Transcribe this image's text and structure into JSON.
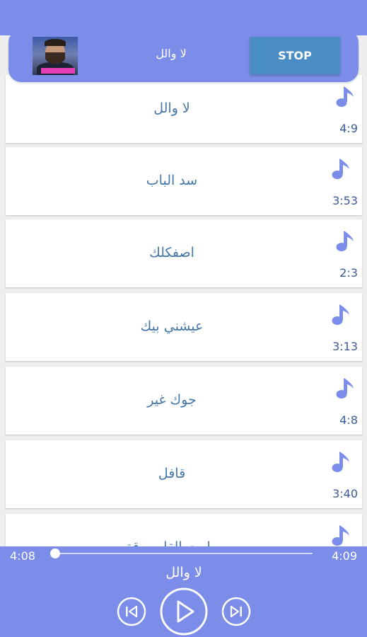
{
  "colors": {
    "accent": "#7b8de8",
    "stop_button": "#4a8cc4",
    "song_text": "#4477aa",
    "duration_text": "#3a5a9a",
    "card_bg": "#ffffff",
    "list_bg": "#eeeeee"
  },
  "header": {
    "thumbnail_icon": "artist-photo",
    "now_playing_title": "لا والل",
    "stop_label": "STOP"
  },
  "songs": [
    {
      "title": "لا والل",
      "duration": "4:9",
      "icon": "music-note-icon"
    },
    {
      "title": "سد الباب",
      "duration": "3:53",
      "icon": "music-note-icon"
    },
    {
      "title": "اصفكلك",
      "duration": "2:3",
      "icon": "music-note-icon"
    },
    {
      "title": "عيشني بيك",
      "duration": "3:13",
      "icon": "music-note-icon"
    },
    {
      "title": "جوك غير",
      "duration": "4:8",
      "icon": "music-note-icon"
    },
    {
      "title": "قافل",
      "duration": "3:40",
      "icon": "music-note-icon"
    },
    {
      "title": "مامت القلب رقة",
      "duration": "",
      "icon": "music-note-icon"
    }
  ],
  "player": {
    "current_time": "4:08",
    "total_time": "4:09",
    "progress": 0.0,
    "title": "لا والل",
    "controls": [
      "skip-previous-icon",
      "play-icon",
      "skip-next-icon"
    ]
  }
}
